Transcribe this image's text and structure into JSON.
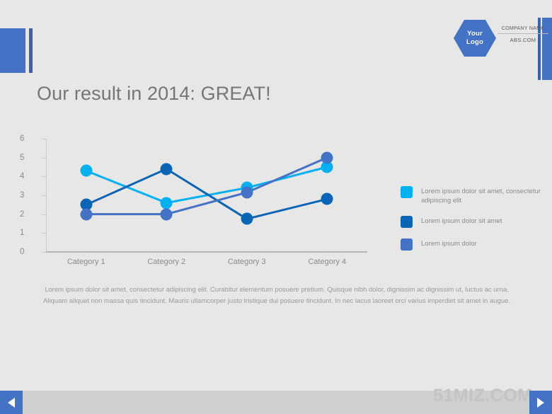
{
  "header": {
    "logo_text_line1": "Your",
    "logo_text_line2": "Logo",
    "company_name": "COMPANY NAME",
    "company_site": "ABS.COM"
  },
  "title": "Our result in 2014: GREAT!",
  "chart_data": {
    "type": "line",
    "title": "",
    "xlabel": "",
    "ylabel": "",
    "ylim": [
      0,
      6
    ],
    "yticks": [
      0,
      1,
      2,
      3,
      4,
      5,
      6
    ],
    "grid": false,
    "legend_position": "right",
    "categories": [
      "Category 1",
      "Category 2",
      "Category 3",
      "Category 4"
    ],
    "series": [
      {
        "name": "Lorem ipsum dolor sit amet, consectetur adipiscing elit",
        "color": "#00b0f0",
        "values": [
          4.3,
          2.6,
          3.4,
          4.5
        ]
      },
      {
        "name": "Lorem ipsum dolor sit amet",
        "color": "#0a66b5",
        "values": [
          2.5,
          4.4,
          1.75,
          2.8
        ]
      },
      {
        "name": "Lorem ipsum dolor",
        "color": "#4472c4",
        "values": [
          2.0,
          2.0,
          3.15,
          5.0
        ]
      }
    ]
  },
  "legend": [
    {
      "label": "Lorem ipsum dolor sit amet, consectetur adipiscing elit",
      "color": "#00b0f0"
    },
    {
      "label": "Lorem ipsum dolor sit amet",
      "color": "#0a66b5"
    },
    {
      "label": "Lorem ipsum dolor",
      "color": "#4472c4"
    }
  ],
  "paragraph": "Lorem ipsum dolor sit amet, consectetur adipiscing elit. Curabitur elementum posuere pretium. Quisque nibh dolor, dignissim ac dignissim ut, luctus ac urna. Aliquam aliquet non massa quis tincidunt. Mauris ullamcorper justo tristique dui posuere tincidunt. In nec lacus laoreet orci varius imperdiet sit amet in augue.",
  "footer": {
    "prev_label": "",
    "next_label": "",
    "watermark": "51MIZ.COM"
  },
  "colors": {
    "accent": "#4472c4",
    "series_light": "#00b0f0",
    "series_dark": "#0a66b5",
    "series_slate": "#4472c4",
    "background": "#e7e7e7"
  }
}
